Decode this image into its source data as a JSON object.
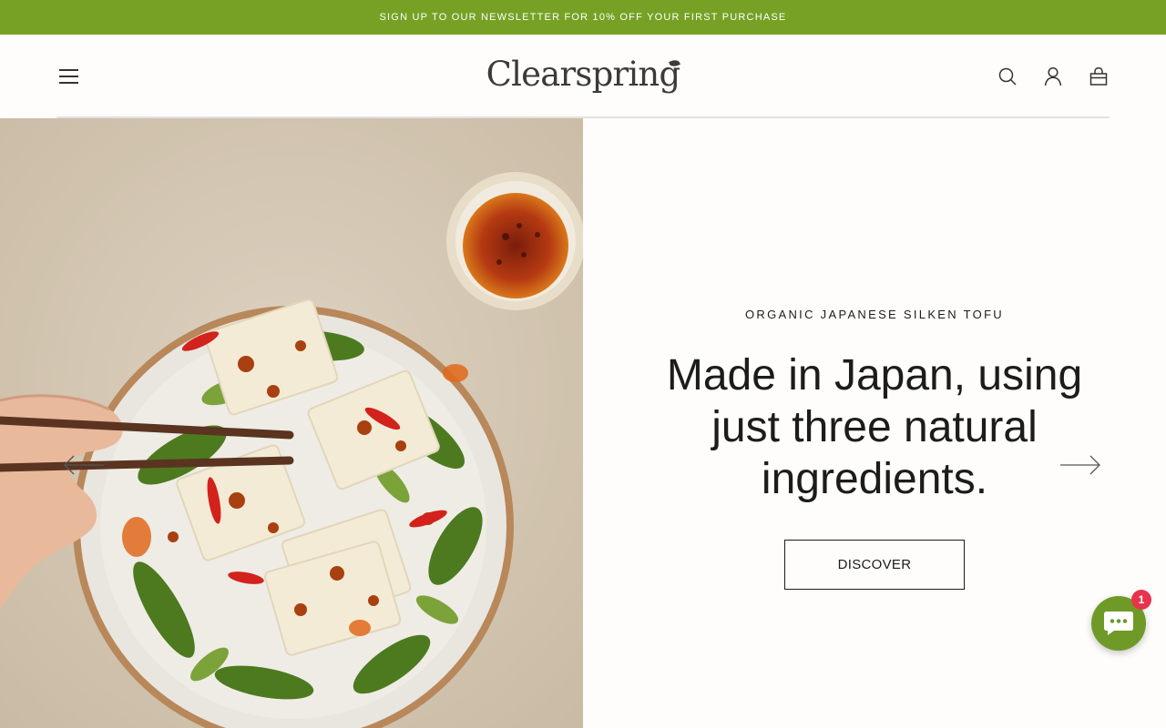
{
  "announcement": {
    "text": "SIGN UP TO OUR NEWSLETTER FOR 10% OFF YOUR FIRST PURCHASE"
  },
  "header": {
    "logo_text": "Clearspring",
    "icons": [
      "menu-icon",
      "search-icon",
      "account-icon",
      "cart-icon"
    ]
  },
  "hero": {
    "eyebrow": "ORGANIC JAPANESE SILKEN TOFU",
    "headline": "Made in Japan, using just three natural ingredients.",
    "cta_label": "DISCOVER",
    "image_alt": "Silken tofu with vegetables and chilli dressing"
  },
  "chat": {
    "badge_count": "1"
  },
  "colors": {
    "announcement_bg": "#76a125",
    "chat_bg": "#6f9a27",
    "badge_bg": "#e8334d",
    "text": "#1c1c1c",
    "background": "#fefdfb"
  }
}
